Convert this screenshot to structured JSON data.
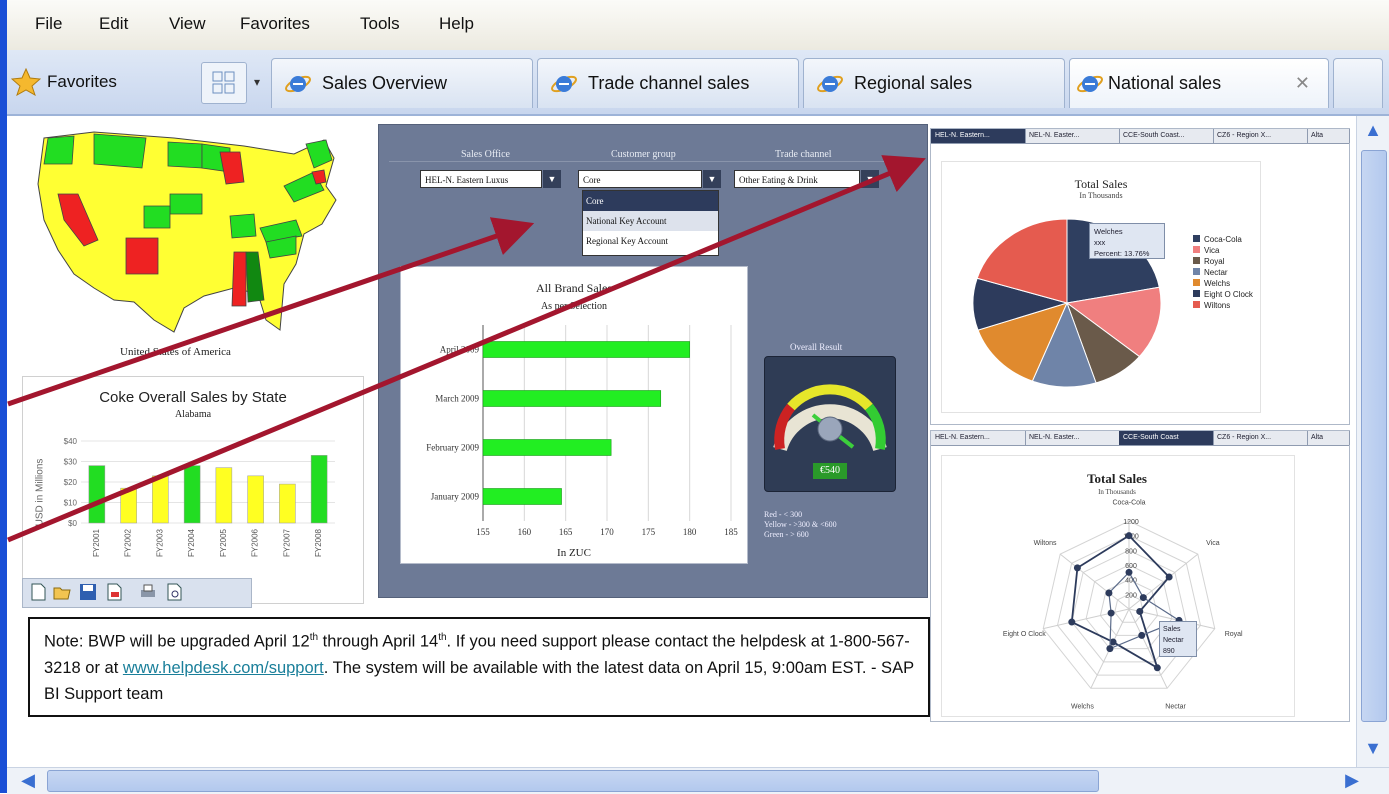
{
  "menu": {
    "items": [
      "File",
      "Edit",
      "View",
      "Favorites",
      "Tools",
      "Help"
    ]
  },
  "tabbar": {
    "favorites_label": "Favorites",
    "tabs": [
      {
        "label": "Sales Overview",
        "active": false
      },
      {
        "label": "Trade channel sales",
        "active": false
      },
      {
        "label": "Regional sales",
        "active": false
      },
      {
        "label": "National sales",
        "active": true
      }
    ],
    "close_glyph": "✕"
  },
  "colors": {
    "accent": "#1a4fd6",
    "arrow": "#a3162e",
    "green": "#22dd22",
    "yellow": "#ffff33",
    "red": "#ee2222",
    "navy": "#2d3b5c"
  },
  "map": {
    "caption": "United States of America"
  },
  "state_chart": {
    "title": "Coke Overall Sales by State",
    "subtitle": "Alabama",
    "ylabel": "USD in Millions",
    "chart_data": {
      "type": "bar",
      "categories": [
        "FY2001",
        "FY2002",
        "FY2003",
        "FY2004",
        "FY2005",
        "FY2006",
        "FY2007",
        "FY2008"
      ],
      "values": [
        28,
        17,
        23,
        28,
        27,
        23,
        19,
        33
      ],
      "colors": [
        "green",
        "yellow",
        "yellow",
        "green",
        "yellow",
        "yellow",
        "yellow",
        "green"
      ],
      "yticks": [
        "$0",
        "$10",
        "$20",
        "$30",
        "$40"
      ],
      "ylim": [
        0,
        40
      ]
    }
  },
  "center": {
    "headers": [
      "Sales Office",
      "Customer group",
      "Trade channel"
    ],
    "dropdowns": [
      "HEL-N. Eastern Luxus",
      "Core",
      "Other Eating & Drink"
    ],
    "dropdown_options": [
      "Core",
      "National Key Account",
      "Regional Key Account"
    ],
    "bar_chart": {
      "title": "All Brand Sales",
      "subtitle": "As per Selection",
      "xlabel": "In ZUC",
      "chart_data": {
        "type": "bar",
        "orientation": "horizontal",
        "categories": [
          "April 2009",
          "March 2009",
          "February 2009",
          "January 2009"
        ],
        "values": [
          180,
          176.5,
          170.5,
          164.5
        ],
        "xticks": [
          155,
          160,
          165,
          170,
          175,
          180,
          185
        ],
        "xlim": [
          155,
          185
        ]
      }
    },
    "gauge": {
      "title": "Overall Result",
      "value_label": "€540",
      "value": 540,
      "legend": [
        "Red - < 300",
        "Yellow - >300 & <600",
        "Green - > 600"
      ]
    }
  },
  "pie_panel": {
    "tabs": [
      "HEL-N. Eastern...",
      "NEL-N. Easter...",
      "CCE-South Coast...",
      "CZ6 - Region X...",
      "Alta"
    ],
    "title": "Total Sales",
    "subtitle": "In Thousands",
    "tooltip": {
      "line1": "Welches",
      "line2": "xxx",
      "line3": "Percent: 13.76%"
    },
    "chart_data": {
      "type": "pie",
      "labels": [
        "Coca-Cola",
        "Vica",
        "Royal",
        "Nectar",
        "Welchs",
        "Eight O Clock",
        "Wiltons"
      ],
      "values": [
        22,
        14,
        9,
        11,
        13.76,
        10,
        20.24
      ],
      "colors": [
        "#2f3f60",
        "#f07f7f",
        "#6a5a4a",
        "#6f84a8",
        "#e08a2e",
        "#2d3b5c",
        "#e55b4f"
      ]
    }
  },
  "radar_panel": {
    "tabs": [
      "HEL-N. Eastern...",
      "NEL-N. Easter...",
      "CCE-South Coast",
      "CZ6 - Region X...",
      "Alta"
    ],
    "title": "Total Sales",
    "subtitle": "In Thousands",
    "tooltip": {
      "line1": "Sales",
      "line2": "Nectar",
      "line3": "890"
    },
    "chart_data": {
      "type": "radar",
      "axes": [
        "Coca-Cola",
        "Vica",
        "Royal",
        "Nectar",
        "Welchs",
        "Eight O Clock",
        "Wiltons"
      ],
      "ticks": [
        200,
        400,
        600,
        800,
        1000,
        1200
      ],
      "series": [
        {
          "values": [
            1000,
            700,
            150,
            890,
            500,
            800,
            900
          ]
        },
        {
          "values": [
            500,
            250,
            700,
            400,
            600,
            250,
            350
          ]
        }
      ]
    }
  },
  "note": {
    "part1": "Note: BWP will be upgraded April 12",
    "sup1": "th",
    "part2": " through April 14",
    "sup2": "th",
    "part3": ". If you need support please contact the helpdesk at 1-800-567-3218 or at ",
    "link": "www.helpdesk.com/support",
    "part4": ". The system will be available with the latest data on April 15, 9:00am EST.  - SAP BI Support team"
  }
}
